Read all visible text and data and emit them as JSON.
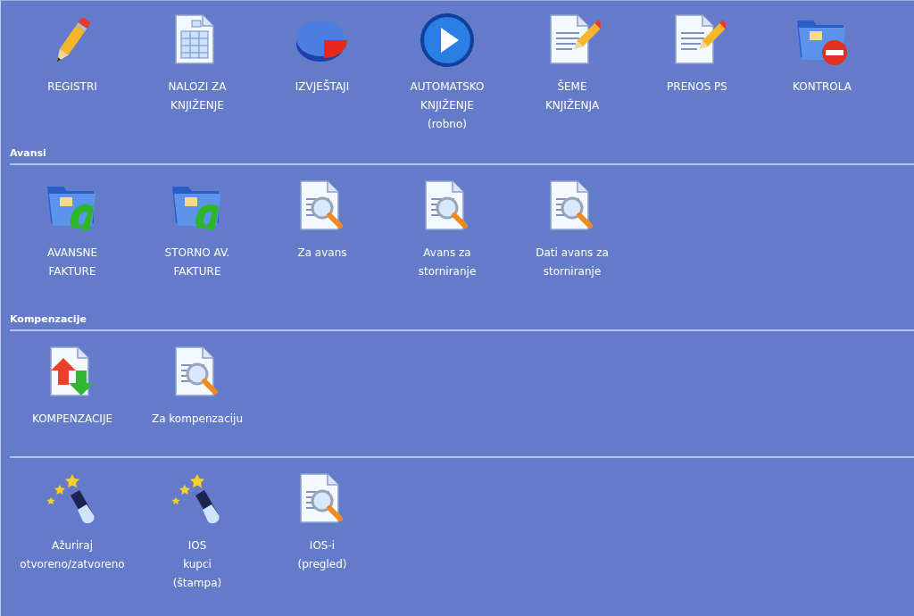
{
  "sections": [
    {
      "items": [
        {
          "kind": "pencil",
          "lines": [
            "REGISTRI"
          ]
        },
        {
          "kind": "sheet",
          "lines": [
            "NALOZI ZA",
            "KNJIŽENJE"
          ]
        },
        {
          "kind": "pie",
          "lines": [
            "IZVJEŠTAJI"
          ]
        },
        {
          "kind": "play",
          "lines": [
            "AUTOMATSKO",
            "KNJIŽENJE",
            "(robno)"
          ]
        },
        {
          "kind": "docpencil",
          "lines": [
            "ŠEME",
            "KNJIŽENJA"
          ]
        },
        {
          "kind": "docpencil",
          "lines": [
            "PRENOS PS"
          ]
        },
        {
          "kind": "folderstop",
          "lines": [
            "KONTROLA"
          ]
        }
      ]
    },
    {
      "heading": "Avansi",
      "items": [
        {
          "kind": "folderletter",
          "lines": [
            "AVANSNE",
            "FAKTURE"
          ]
        },
        {
          "kind": "folderletter",
          "lines": [
            "STORNO AV.",
            "FAKTURE"
          ]
        },
        {
          "kind": "docsearch",
          "lines": [
            "Za avans"
          ]
        },
        {
          "kind": "docsearch",
          "lines": [
            "Avans za",
            "storniranje"
          ]
        },
        {
          "kind": "docsearch",
          "lines": [
            "Dati avans za",
            "storniranje"
          ]
        }
      ]
    },
    {
      "heading": "Kompenzacije",
      "items": [
        {
          "kind": "docarrows",
          "lines": [
            "KOMPENZACIJE"
          ]
        },
        {
          "kind": "docsearch",
          "lines": [
            "Za kompenzaciju"
          ]
        }
      ]
    },
    {
      "items": [
        {
          "kind": "wand",
          "lines": [
            "Ažuriraj",
            "otvoreno/zatvoreno"
          ]
        },
        {
          "kind": "wand",
          "lines": [
            "IOS",
            "kupci",
            "(štampa)"
          ]
        },
        {
          "kind": "docsearch",
          "lines": [
            "IOS-i",
            "(pregled)"
          ]
        }
      ]
    }
  ]
}
